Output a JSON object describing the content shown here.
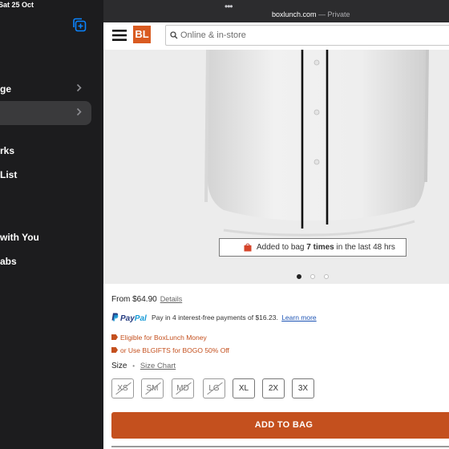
{
  "status": {
    "date": "Sat 25 Oct"
  },
  "sidebar": {
    "items": [
      {
        "label": "ge",
        "chevron": true,
        "selected": false
      },
      {
        "label": "",
        "chevron": true,
        "selected": true
      },
      {
        "label": "rks",
        "chevron": false,
        "selected": false
      },
      {
        "label": "List",
        "chevron": false,
        "selected": false
      },
      {
        "label": "with You",
        "chevron": false,
        "selected": false
      },
      {
        "label": "abs",
        "chevron": false,
        "selected": false
      }
    ]
  },
  "browser": {
    "url": "boxlunch.com",
    "mode": "— Private",
    "dots": "•••"
  },
  "site": {
    "logo": "BL",
    "search_placeholder": "Online & in-store"
  },
  "product": {
    "bag_banner": {
      "pre": "Added to bag",
      "count": "7 times",
      "post": "in the last 48 hrs"
    },
    "carousel": {
      "count": 3,
      "active": 0
    },
    "price_label": "From $64.90",
    "details_link": "Details",
    "paypal": {
      "logo_pay": "Pay",
      "logo_pal": "Pal",
      "text": "Pay in 4 interest-free payments of $16.23.",
      "learn_more": "Learn more"
    },
    "promos": [
      "Eligible for BoxLunch Money",
      "or Use BLGIFTS for BOGO 50% Off"
    ],
    "size_label": "Size",
    "size_separator": "•",
    "size_chart_link": "Size Chart",
    "sizes": [
      {
        "label": "XS",
        "available": false
      },
      {
        "label": "SM",
        "available": false
      },
      {
        "label": "MD",
        "available": false
      },
      {
        "label": "LG",
        "available": false
      },
      {
        "label": "XL",
        "available": true
      },
      {
        "label": "2X",
        "available": true
      },
      {
        "label": "3X",
        "available": true
      }
    ],
    "add_to_bag": "ADD TO BAG"
  },
  "colors": {
    "brand": "#d95b21",
    "cta": "#c4501e",
    "sidebar_bg": "#1c1c1e",
    "sidebar_selected": "#3a3a3c",
    "toolbar_bg": "#2c2c2e",
    "link_blue": "#1f55b5",
    "paypal_dark": "#253b80",
    "paypal_light": "#179bd7"
  }
}
